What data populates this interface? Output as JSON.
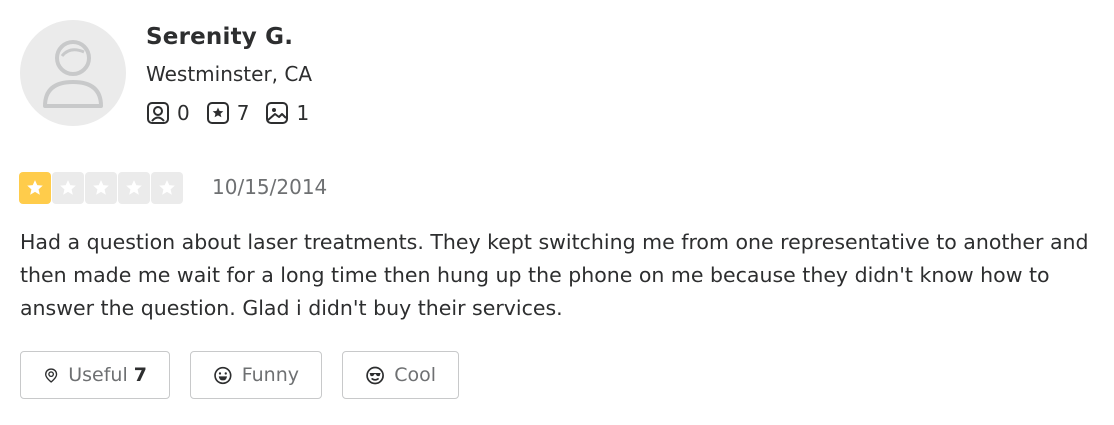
{
  "user": {
    "name": "Serenity G.",
    "location": "Westminster, CA",
    "stats": {
      "friends": "0",
      "reviews": "7",
      "photos": "1"
    }
  },
  "review": {
    "rating": 1,
    "max_rating": 5,
    "date": "10/15/2014",
    "text": "Had a question about laser treatments. They kept switching me from one representative to another and then made me wait for a long time then hung up the phone on me because they didn't know how to answer the question. Glad i didn't buy their services."
  },
  "reactions": {
    "useful_label": "Useful",
    "useful_count": "7",
    "funny_label": "Funny",
    "cool_label": "Cool"
  },
  "colors": {
    "star_filled": "#ffcc4b",
    "star_empty": "#ebebeb",
    "text_primary": "#2d2e2f",
    "text_secondary": "#6e7072",
    "border": "#c8c9ca"
  },
  "icons": [
    "avatar-placeholder",
    "friends-icon",
    "review-star-icon",
    "photo-icon",
    "star-icon",
    "useful-icon",
    "funny-icon",
    "cool-icon"
  ]
}
